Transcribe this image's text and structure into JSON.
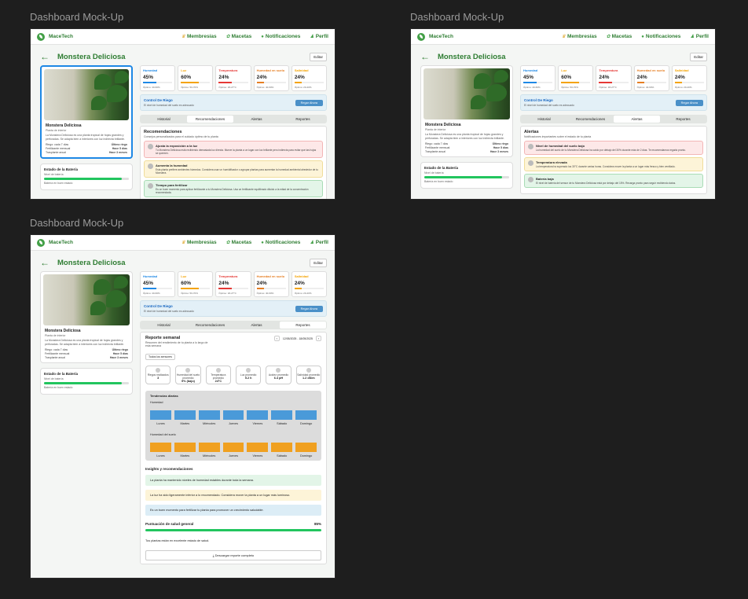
{
  "mockups": [
    {
      "label": "Dashboard Mock-Up"
    },
    {
      "label": "Dashboard Mock-Up"
    },
    {
      "label": "Dashboard Mock-Up"
    }
  ],
  "app": {
    "brand": "MaceTech",
    "nav": [
      "Membresías",
      "Macetas",
      "Notificaciones",
      "Perfil"
    ],
    "page_title": "Monstera Deliciosa",
    "edit_label": "Editar"
  },
  "plant": {
    "name": "Monstera Deliciosa",
    "subtitle": "Planta de interior",
    "description": "La Monstera Deliciosa es una planta tropical de hojas grandes y perforadas. Se adapta bien a interiores con luz indirecta brillante.",
    "rows": [
      {
        "label": "Riego: cada 7 días",
        "value": "Último riego"
      },
      {
        "label": "Fertilizante mensual",
        "value": "Hace 5 días"
      },
      {
        "label": "Trasplante anual",
        "value": "Hace 3 meses"
      }
    ]
  },
  "battery": {
    "title": "Estado de la Batería",
    "subtitle": "Nivel de batería",
    "note": "Batería en buen estado",
    "level": 0.92
  },
  "metrics": [
    {
      "label": "Humedad",
      "value": "45%",
      "optimal": "Óptimo: 40-60%",
      "color": "#1e88e5",
      "fill": 0.45
    },
    {
      "label": "Luz",
      "value": "60%",
      "optimal": "Óptimo: 50-70%",
      "color": "#f4a300",
      "fill": 0.6
    },
    {
      "label": "Temperatura",
      "value": "24%",
      "optimal": "Óptimo: 18-27°C",
      "color": "#e53935",
      "fill": 0.45
    },
    {
      "label": "Humedad en suelo",
      "value": "24%",
      "optimal": "Óptimo: 40-60%",
      "color": "#e67e22",
      "fill": 0.24
    },
    {
      "label": "Salinidad",
      "value": "24%",
      "optimal": "Óptimo: 20-40%",
      "color": "#f4a300",
      "fill": 0.24
    }
  ],
  "risk": {
    "title": "Control De Riego",
    "subtitle": "El nivel de humedad del suelo es adecuado",
    "button": "Regar Ahora"
  },
  "tabs": [
    "Historial",
    "Recomendaciones",
    "Alertas",
    "Reportes"
  ],
  "recommendations": {
    "title": "Recomendaciones",
    "subtitle": "Consejos personalizados para el cuidado óptimo de tu planta",
    "items": [
      {
        "title": "Ajusta la exposición a la luz",
        "text": "Tu Monstera Deliciosa está recibiendo demasiada luz directa. Mueve la planta a un lugar con luz brillante pero indirecta para evitar que las hojas se quemen."
      },
      {
        "title": "Aumenta la humedad",
        "text": "Esta planta prefiere ambientes húmedos. Considera usar un humidificador o agrupar plantas para aumentar la humedad ambiental alrededor de tu Monstera."
      },
      {
        "title": "Tiempo para fertilizar",
        "text": "Es un buen momento para aplicar fertilizante a tu Monstera Deliciosa. Usa un fertilizante equilibrado diluido a la mitad de la concentración recomendada."
      }
    ]
  },
  "alerts": {
    "title": "Alertas",
    "subtitle": "Notificaciones importantes sobre el estado de tu planta",
    "items": [
      {
        "title": "Nivel de humedad del suelo bajo",
        "text": "La humedad del suelo de tu Monstera Deliciosa ha caído por debajo del 30% durante más de 2 días. Te recomendamos regarla pronto."
      },
      {
        "title": "Temperatura elevada",
        "text": "La temperatura ha superado los 30°C durante varias horas. Considera mover la planta a un lugar más fresco y bien ventilado."
      },
      {
        "title": "Batería baja",
        "text": "El nivel de batería del sensor de tu Monstera Deliciosa está por debajo del 15%. Recarga pronto para seguir recibiendo datos."
      }
    ]
  },
  "report": {
    "title": "Reporte semanal",
    "subtitle": "Resumen del rendimiento de tu planta a lo largo de esta semana",
    "date_range": "12/05/2025 - 18/05/2025",
    "save_label": "Todos los sensores",
    "stats": [
      {
        "label": "Riegos realizados",
        "value": "3"
      },
      {
        "label": "Humedad del suelo promedio",
        "value": "9% (bajo)"
      },
      {
        "label": "Temperatura promedio",
        "value": "24°C"
      },
      {
        "label": "Luz promedio",
        "value": "5.2 h"
      },
      {
        "label": "Acidez promedio",
        "value": "6.4 pH"
      },
      {
        "label": "Salinidad promedio",
        "value": "1.2 dS/m"
      }
    ],
    "trends_title": "Tendencias diarias",
    "humidity_label": "Humedad",
    "soil_label": "Humedad del suelo",
    "days": [
      "Lunes",
      "Martes",
      "Miércoles",
      "Jueves",
      "Viernes",
      "Sábado",
      "Domingo"
    ],
    "humidity_color": "#4a9ad9",
    "soil_color": "#f0a020",
    "insights_title": "Insights y recomendaciones",
    "insights": [
      {
        "text": "La planta ha mantenido niveles de humedad estables durante toda la semana.",
        "tone": "grn"
      },
      {
        "text": "La luz ha sido ligeramente inferior a lo recomendado. Considera mover la planta a un lugar más luminoso.",
        "tone": "yel"
      },
      {
        "text": "Es un buen momento para fertilizar tu planta para promover un crecimiento saludable.",
        "tone": "blu"
      }
    ],
    "health_label": "Puntuación de salud general",
    "health_value": "85%",
    "health_note": "Tus plantas están en excelente estado de salud.",
    "download": "Descargar reporte completo"
  }
}
